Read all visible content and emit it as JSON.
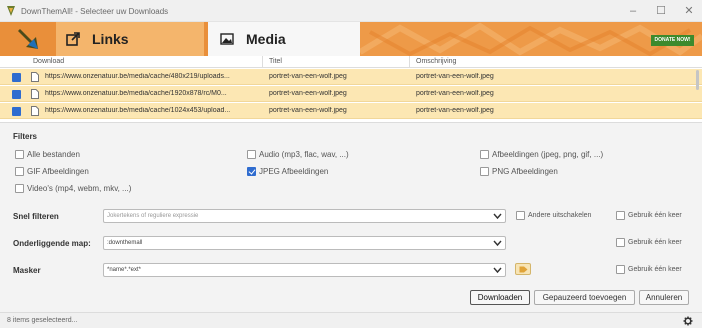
{
  "window": {
    "title": "DownThemAll! - Selecteer uw Downloads",
    "controls": {
      "minimize": "–",
      "maximize": "☐",
      "close": "✕"
    }
  },
  "tabs": [
    {
      "label": "Links",
      "icon": "external-link-icon",
      "active": false
    },
    {
      "label": "Media",
      "icon": "image-icon",
      "active": true
    }
  ],
  "donate_label": "DONATE NOW!",
  "table": {
    "columns": [
      "Download",
      "Titel",
      "Omschrijving"
    ],
    "rows": [
      {
        "checked": true,
        "url": "https://www.onzenatuur.be/media/cache/480x219/uploads...",
        "title": "portret-van-een-wolf.jpeg",
        "description": "portret-van-een-wolf.jpeg"
      },
      {
        "checked": true,
        "url": "https://www.onzenatuur.be/media/cache/1920x878/rc/M0...",
        "title": "portret-van-een-wolf.jpeg",
        "description": "portret-van-een-wolf.jpeg"
      },
      {
        "checked": true,
        "url": "https://www.onzenatuur.be/media/cache/1024x453/upload...",
        "title": "portret-van-een-wolf.jpeg",
        "description": "portret-van-een-wolf.jpeg"
      }
    ]
  },
  "filters": {
    "title": "Filters",
    "options": [
      {
        "label": "Alle bestanden",
        "checked": false
      },
      {
        "label": "Audio (mp3, flac, wav, ...)",
        "checked": false
      },
      {
        "label": "Afbeeldingen (jpeg, png, gif, ...)",
        "checked": false
      },
      {
        "label": "GIF Afbeeldingen",
        "checked": false
      },
      {
        "label": "JPEG Afbeeldingen",
        "checked": true
      },
      {
        "label": "PNG Afbeeldingen",
        "checked": false
      },
      {
        "label": "Video's (mp4, webm, mkv, ...)",
        "checked": false
      }
    ]
  },
  "form": {
    "quick_filter": {
      "label": "Snel filteren",
      "placeholder": "Jokertekens of reguliere expressie",
      "value": ""
    },
    "disable_others_label": "Andere uitschakelen",
    "use_once_label": "Gebruik één keer",
    "folder": {
      "label": "Onderliggende map:",
      "value": ":downthemall"
    },
    "mask": {
      "label": "Masker",
      "value": "*name*.*ext*"
    }
  },
  "buttons": {
    "download": "Downloaden",
    "add_paused": "Gepauzeerd toevoegen",
    "cancel": "Annuleren"
  },
  "status": "8 items geselecteerd...",
  "colors": {
    "header_orange": "#e98f3a",
    "selected_row": "#fce7b3",
    "checkbox_blue": "#2f6ccf"
  }
}
